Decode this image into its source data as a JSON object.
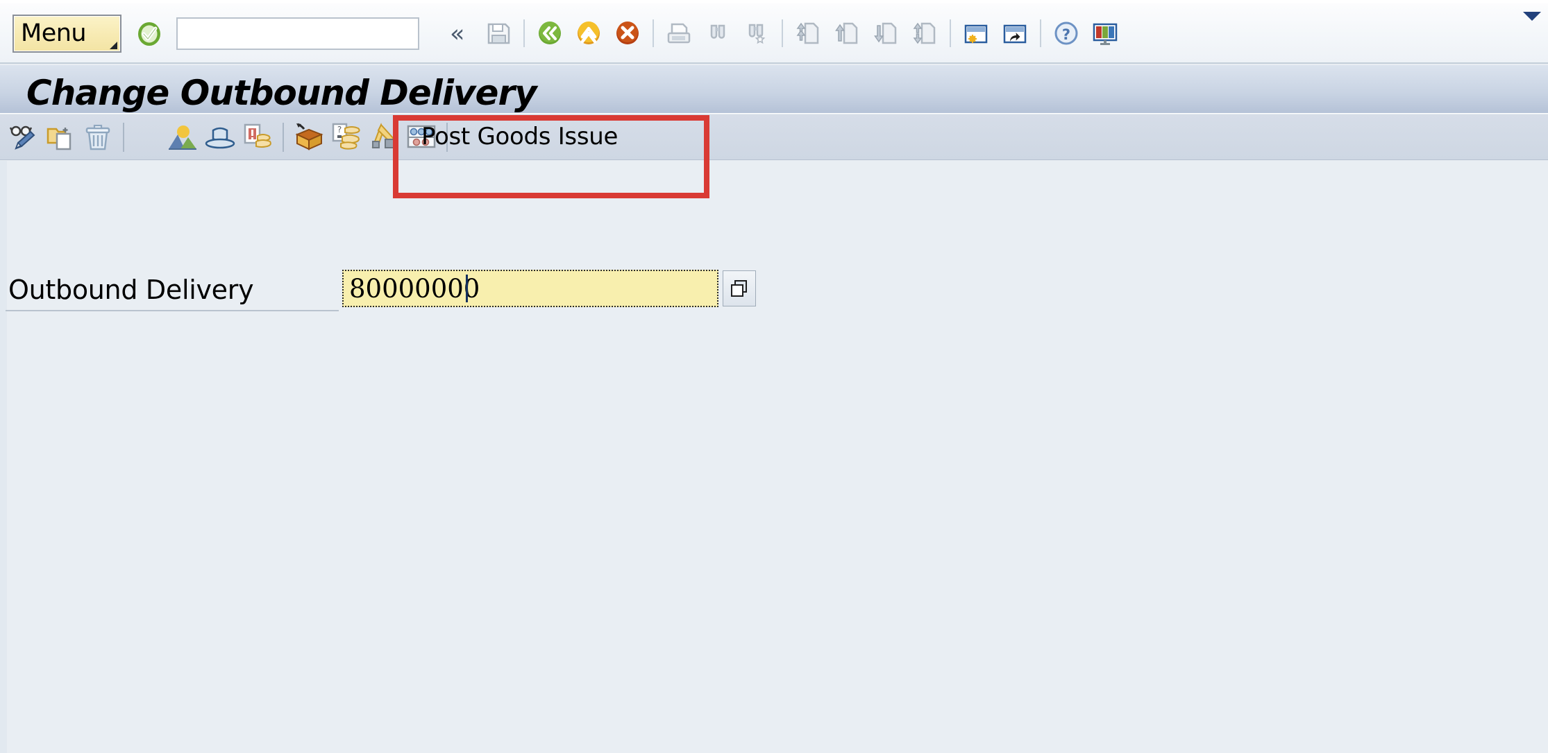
{
  "window": {
    "title": "Change Outbound Delivery"
  },
  "system_toolbar": {
    "menu_button_label": "Menu",
    "command_field_value": "",
    "command_field_placeholder": "",
    "collapse_glyph": "«",
    "icons": [
      {
        "name": "enter-check-icon",
        "title": "Enter"
      },
      {
        "name": "save-icon",
        "title": "Save"
      },
      {
        "name": "back-icon",
        "title": "Back"
      },
      {
        "name": "exit-icon",
        "title": "Exit"
      },
      {
        "name": "cancel-icon",
        "title": "Cancel"
      },
      {
        "name": "print-icon",
        "title": "Print"
      },
      {
        "name": "find-icon",
        "title": "Find"
      },
      {
        "name": "find-next-icon",
        "title": "Find Next"
      },
      {
        "name": "first-page-icon",
        "title": "First Page"
      },
      {
        "name": "previous-page-icon",
        "title": "Previous Page"
      },
      {
        "name": "next-page-icon",
        "title": "Next Page"
      },
      {
        "name": "last-page-icon",
        "title": "Last Page"
      },
      {
        "name": "create-session-icon",
        "title": "Create New Session"
      },
      {
        "name": "create-shortcut-icon",
        "title": "Create Shortcut"
      },
      {
        "name": "help-icon",
        "title": "Help"
      },
      {
        "name": "customize-layout-icon",
        "title": "Customize Local Layout"
      }
    ]
  },
  "app_toolbar": {
    "icons": [
      {
        "name": "display-change-icon",
        "title": "Display/Change"
      },
      {
        "name": "copy-document-icon",
        "title": "Copy"
      },
      {
        "name": "delete-icon",
        "title": "Delete"
      },
      {
        "name": "overview-icon",
        "title": "Overview"
      },
      {
        "name": "header-details-icon",
        "title": "Header Details"
      },
      {
        "name": "item-details-icon",
        "title": "Item Details"
      },
      {
        "name": "packing-icon",
        "title": "Pack"
      },
      {
        "name": "batch-split-icon",
        "title": "Batch Split"
      },
      {
        "name": "pick-confirm-icon",
        "title": "Picking"
      },
      {
        "name": "serial-numbers-icon",
        "title": "Serial Numbers"
      }
    ],
    "post_goods_issue_label": "Post Goods Issue"
  },
  "main": {
    "outbound_delivery_label": "Outbound Delivery",
    "outbound_delivery_value": "80000000",
    "matchcode_icon": "value-help-icon"
  },
  "annotation": {
    "highlight_color": "#d93a34",
    "target": "post-goods-issue-button"
  },
  "colors": {
    "background": "#e9eef3",
    "title_bar": "#c8d3e3",
    "app_toolbar": "#d1dae6",
    "input_field": "#f8efae",
    "menu_button": "#f7eab2",
    "accent_red": "#d93a34"
  }
}
